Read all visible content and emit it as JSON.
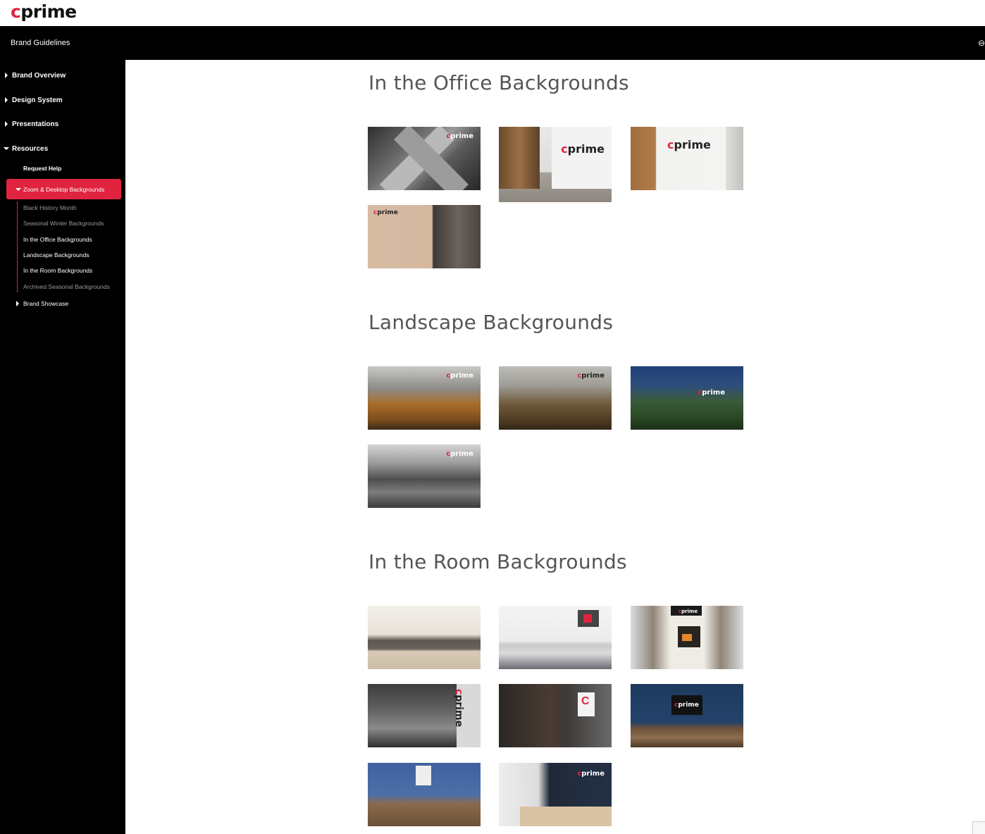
{
  "header": {
    "logo_c": "c",
    "logo_rest": "prime"
  },
  "titlebar": {
    "title": "Brand Guidelines"
  },
  "sidebar": {
    "items": [
      {
        "label": "Brand Overview"
      },
      {
        "label": "Design System"
      },
      {
        "label": "Presentations"
      },
      {
        "label": "Resources"
      }
    ],
    "resources_children": {
      "request_help": "Request Help",
      "zoom_backgrounds": "Zoom & Desktop Backgrounds",
      "zoom_children": [
        "Black History Month",
        "Seasonal Winter Backgrounds",
        "In the Office Backgrounds",
        "Landscape Backgrounds",
        "In the Room Backgrounds",
        "Archived Seasonal Backgrounds"
      ],
      "brand_showcase": "Brand Showcase"
    }
  },
  "sections": [
    {
      "title": "In the Office Backgrounds"
    },
    {
      "title": "Landscape Backgrounds"
    },
    {
      "title": "In the Room Backgrounds"
    }
  ],
  "thumbnail_logo": {
    "c": "c",
    "rest": "prime"
  },
  "colors": {
    "brand_red": "#e0243f",
    "sidebar_bg": "#000000"
  }
}
